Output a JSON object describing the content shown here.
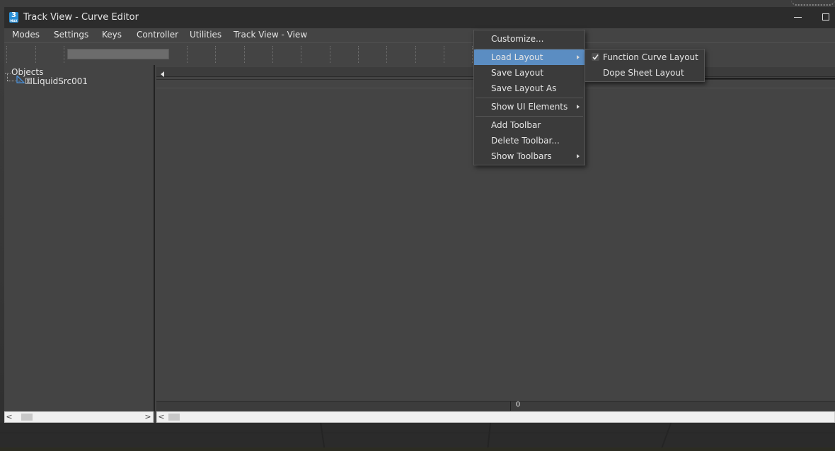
{
  "window": {
    "title": "Track View - Curve Editor",
    "app_icon_text": "3",
    "app_icon_subtext": "MAX"
  },
  "menubar": {
    "items": [
      {
        "label": "Modes"
      },
      {
        "label": "Settings"
      },
      {
        "label": "Keys"
      },
      {
        "label": "Controller"
      },
      {
        "label": "Utilities"
      },
      {
        "label": "Track View - View"
      }
    ]
  },
  "tree": {
    "root_label": "Objects",
    "children": [
      {
        "label": "LiquidSrc001",
        "expand_glyph": "⊞"
      }
    ]
  },
  "time_ruler": {
    "zero_label": "0"
  },
  "context_menu": {
    "items": [
      {
        "label": "Customize..."
      },
      {
        "label": "Load Layout",
        "submenu": true,
        "highlighted": true
      },
      {
        "label": "Save Layout"
      },
      {
        "label": "Save Layout As"
      },
      {
        "label": "Show UI Elements",
        "submenu": true
      },
      {
        "label": "Add Toolbar"
      },
      {
        "label": "Delete Toolbar..."
      },
      {
        "label": "Show Toolbars",
        "submenu": true
      }
    ]
  },
  "submenu": {
    "items": [
      {
        "label": "Function Curve Layout",
        "checked": true
      },
      {
        "label": "Dope Sheet Layout",
        "checked": false
      }
    ]
  },
  "scrollbars": {
    "left_arrow_glyph": "<",
    "right_arrow_glyph": ">"
  },
  "colors": {
    "highlight": "#5b8dc2",
    "app_icon": "#2a8fd6"
  },
  "icons": [
    "app-logo-icon",
    "minimize-icon",
    "maximize-icon",
    "submenu-arrow-icon",
    "checkmark-icon",
    "object-node-icon",
    "expand-icon",
    "scroll-left-icon",
    "scroll-right-icon"
  ]
}
